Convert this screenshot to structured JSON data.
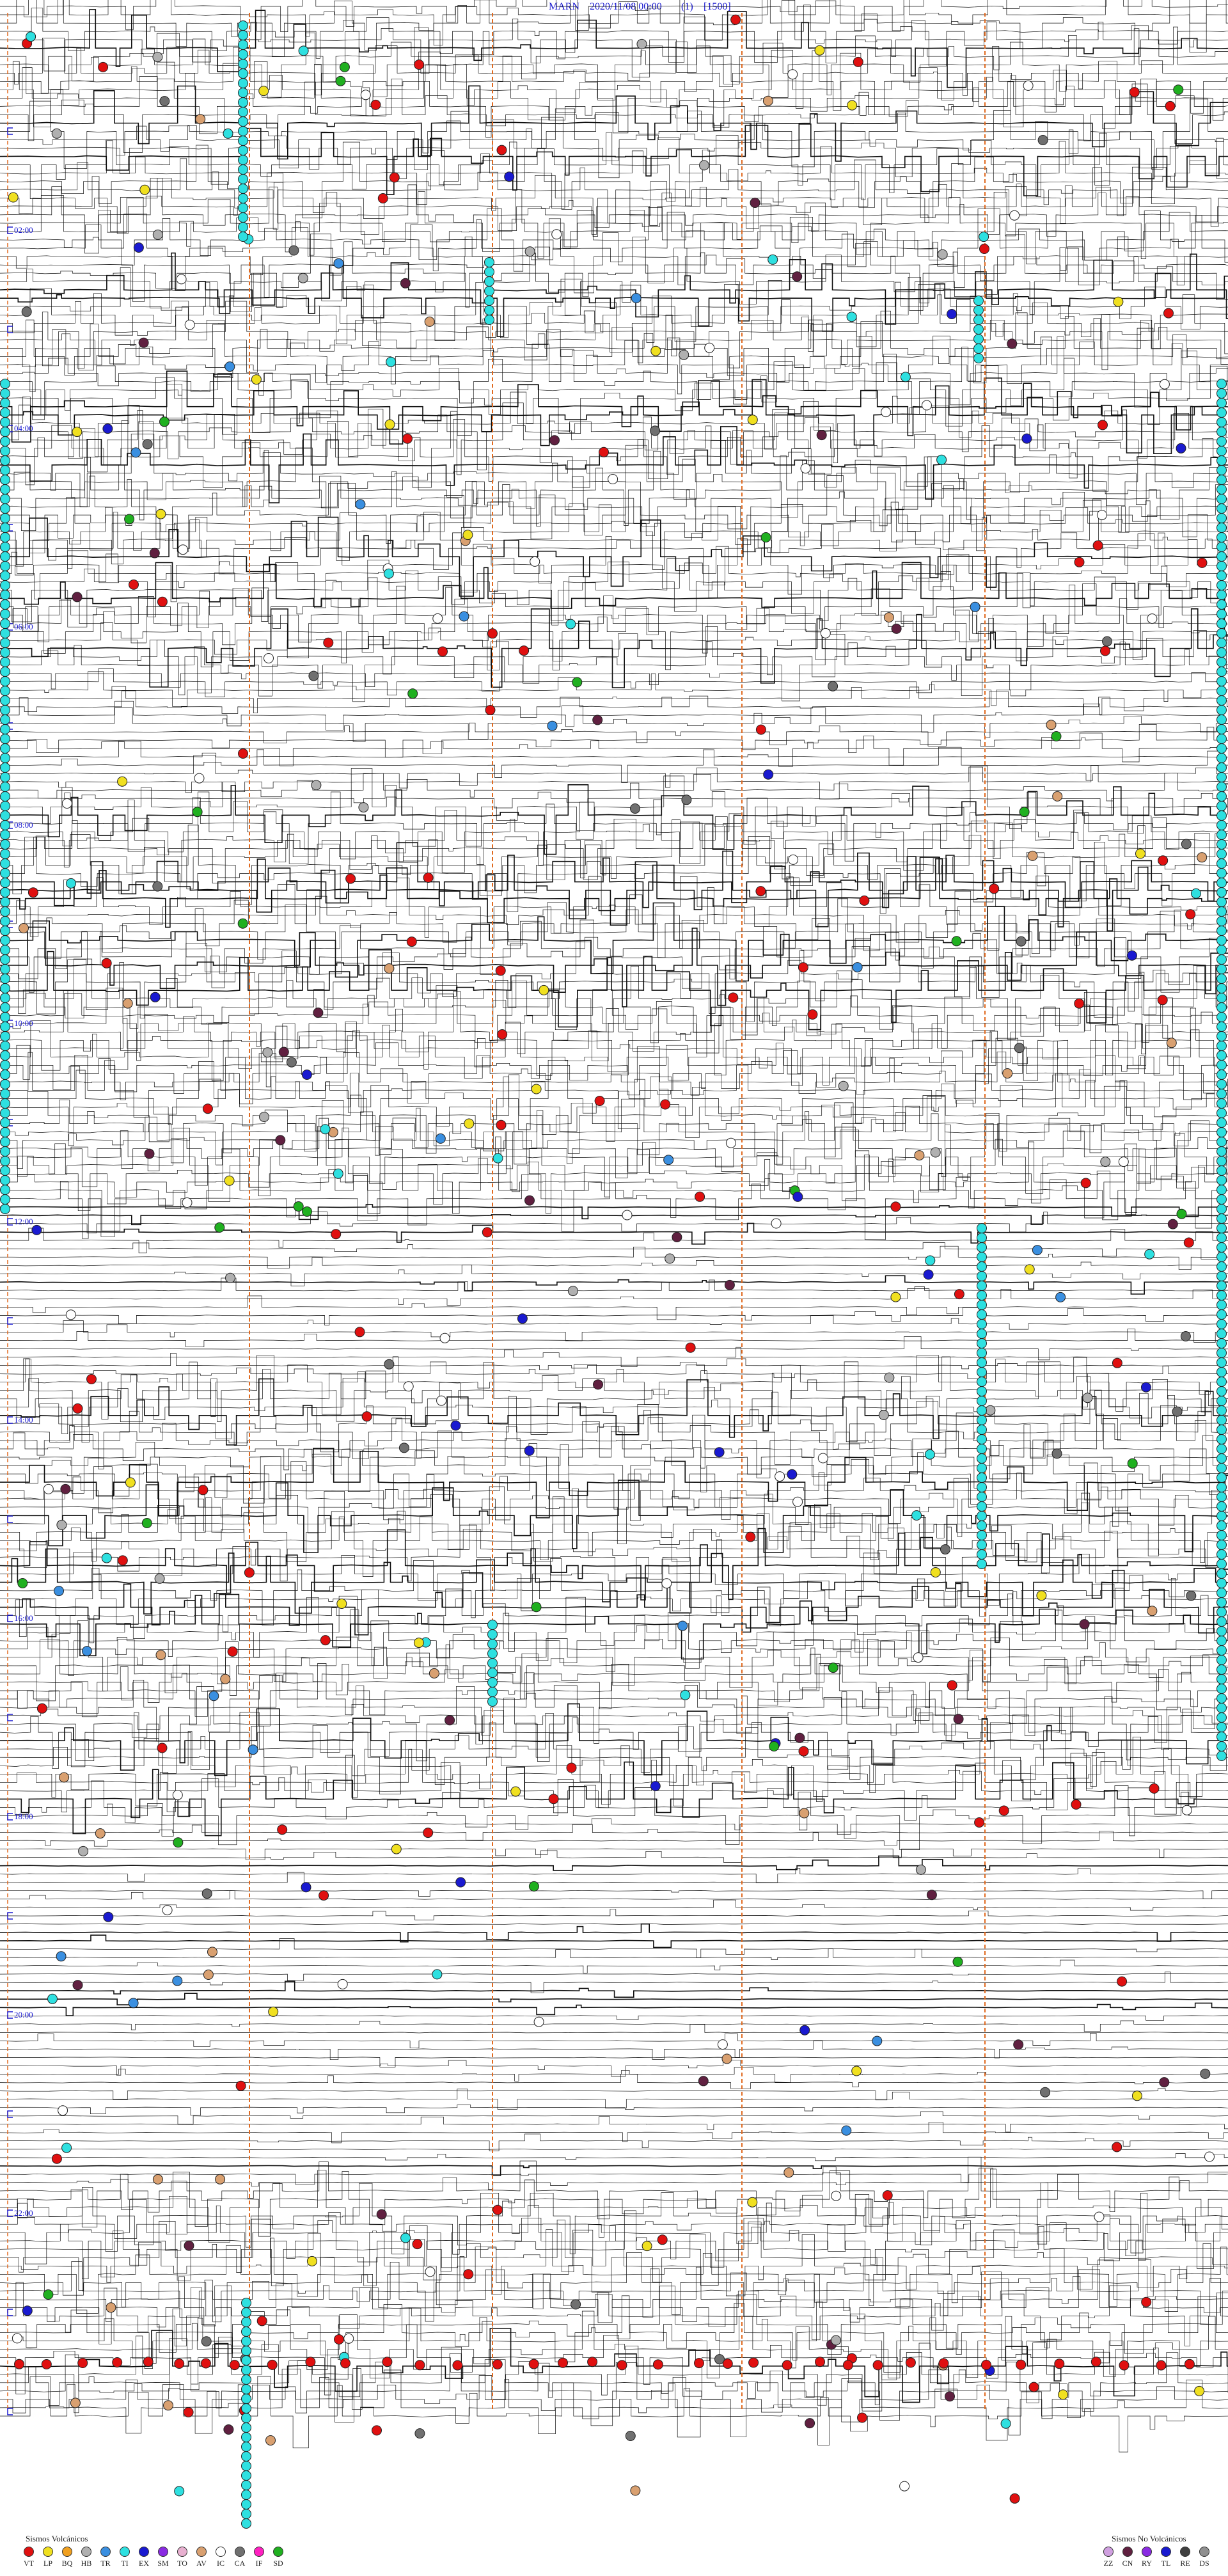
{
  "header": {
    "station": "MARN",
    "datetime": "2020/11/08 00:00",
    "channel": "(1)",
    "scale": "[1500]"
  },
  "hour_labels": [
    "02:00",
    "04:00",
    "06:00",
    "08:00",
    "10:00",
    "12:00",
    "14:00",
    "16:00",
    "18:00",
    "20:00",
    "22:00"
  ],
  "legend": {
    "volcanic_title": "Sismos Volcánicos",
    "volcanic": [
      {
        "code": "VT",
        "color": "#e01010"
      },
      {
        "code": "LP",
        "color": "#f0e020"
      },
      {
        "code": "BQ",
        "color": "#f0a020"
      },
      {
        "code": "HB",
        "color": "#b0b0b0"
      },
      {
        "code": "TR",
        "color": "#3a8fe0"
      },
      {
        "code": "TI",
        "color": "#2ee0e0"
      },
      {
        "code": "EX",
        "color": "#1a1ad0"
      },
      {
        "code": "SM",
        "color": "#8a2be2"
      },
      {
        "code": "TO",
        "color": "#e8b0d0"
      },
      {
        "code": "AV",
        "color": "#d9a070"
      },
      {
        "code": "IC",
        "color": "#ffffff"
      },
      {
        "code": "CA",
        "color": "#707070"
      },
      {
        "code": "IF",
        "color": "#ff20c0"
      },
      {
        "code": "SD",
        "color": "#20b020"
      }
    ],
    "non_volcanic_title": "Sismos No Volcánicos",
    "non_volcanic": [
      {
        "code": "ZZ",
        "color": "#d0a0e0"
      },
      {
        "code": "CN",
        "color": "#602040"
      },
      {
        "code": "RY",
        "color": "#8a2be2"
      },
      {
        "code": "TL",
        "color": "#1a1ad0"
      },
      {
        "code": "RE",
        "color": "#404040"
      },
      {
        "code": "DS",
        "color": "#909090"
      }
    ]
  }
}
